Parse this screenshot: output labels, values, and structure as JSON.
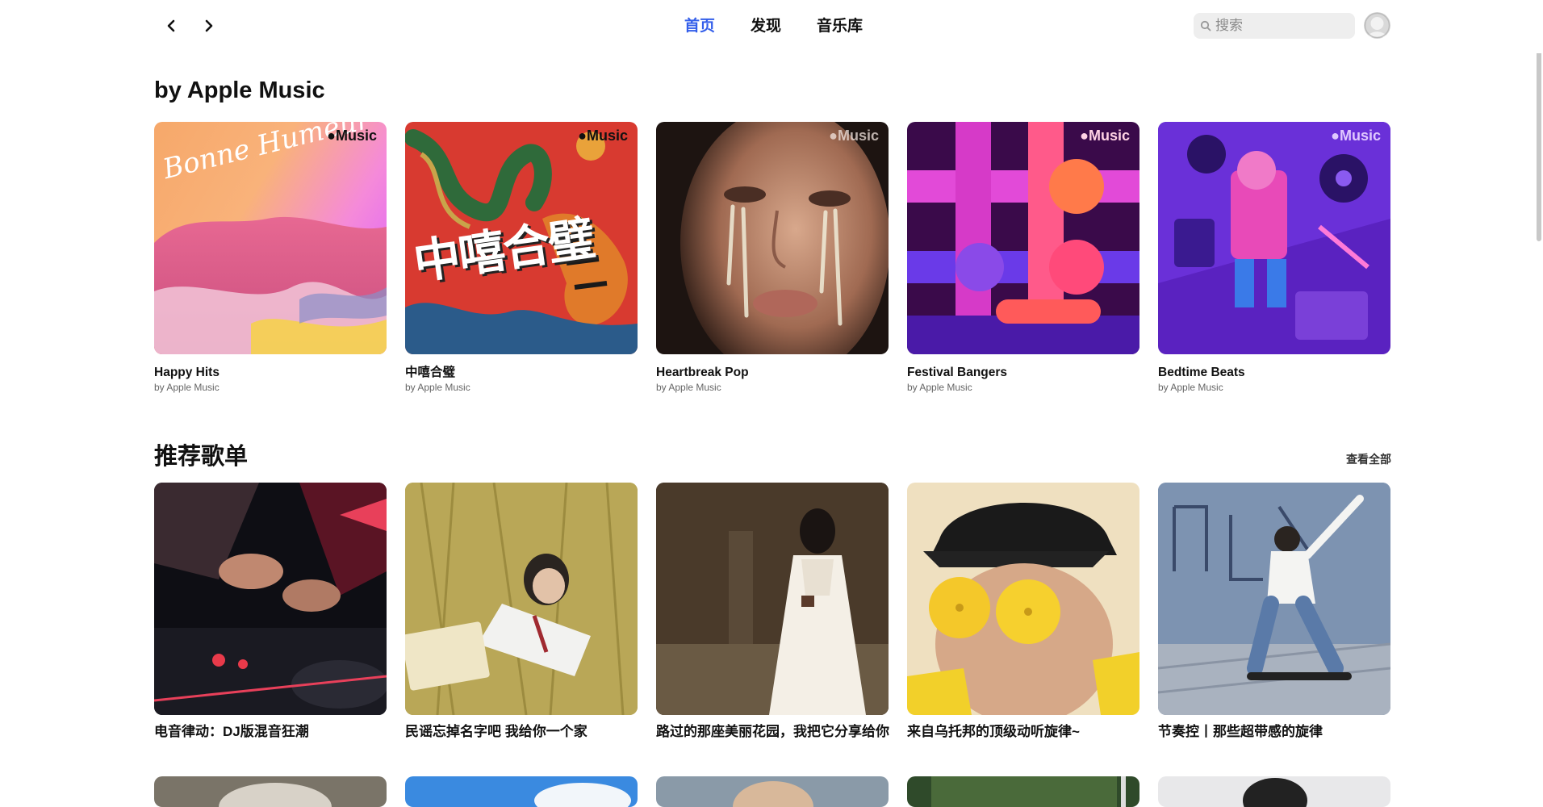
{
  "nav": {
    "back": "back",
    "forward": "forward",
    "tabs": [
      {
        "label": "首页",
        "active": true
      },
      {
        "label": "发现",
        "active": false
      },
      {
        "label": "音乐库",
        "active": false
      }
    ],
    "search_placeholder": "搜索",
    "accent_color": "#335eea"
  },
  "apple_music": {
    "title": "by Apple Music",
    "badge": "Music",
    "items": [
      {
        "title": "Happy Hits",
        "subtitle": "by Apple Music",
        "cover_text": "Bonne Humeur"
      },
      {
        "title": "中嘻合璧",
        "subtitle": "by Apple Music",
        "cover_text": "中嘻合璧"
      },
      {
        "title": "Heartbreak Pop",
        "subtitle": "by Apple Music"
      },
      {
        "title": "Festival Bangers",
        "subtitle": "by Apple Music"
      },
      {
        "title": "Bedtime Beats",
        "subtitle": "by Apple Music"
      }
    ]
  },
  "recommended": {
    "title": "推荐歌单",
    "see_all": "查看全部",
    "items": [
      {
        "title": "电音律动：DJ版混音狂潮"
      },
      {
        "title": "民谣忘掉名字吧 我给你一个家"
      },
      {
        "title": "路过的那座美丽花园，我把它分享给你"
      },
      {
        "title": "来自乌托邦的顶级动听旋律~"
      },
      {
        "title": "节奏控丨那些超带感的旋律"
      }
    ]
  }
}
